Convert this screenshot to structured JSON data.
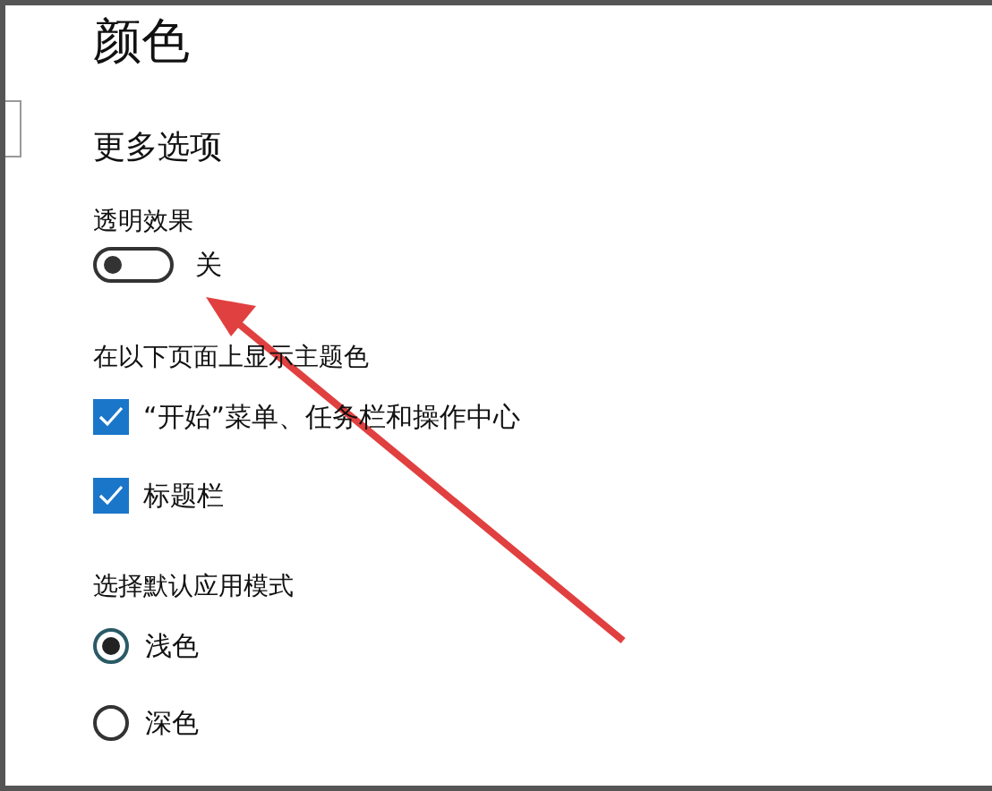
{
  "page_title": "颜色",
  "section_title": "更多选项",
  "transparency": {
    "label": "透明效果",
    "on": false,
    "state_text": "关"
  },
  "accent_surfaces": {
    "heading": "在以下页面上显示主题色",
    "options": [
      {
        "label": "“开始”菜单、任务栏和操作中心",
        "checked": true
      },
      {
        "label": "标题栏",
        "checked": true
      }
    ]
  },
  "app_mode": {
    "heading": "选择默认应用模式",
    "options": [
      {
        "label": "浅色",
        "selected": true
      },
      {
        "label": "深色",
        "selected": false
      }
    ]
  }
}
